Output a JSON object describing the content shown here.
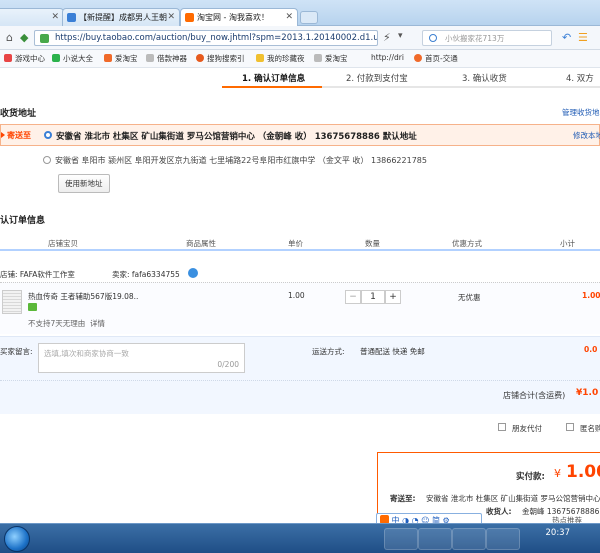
{
  "browser": {
    "tabs": [
      {
        "label": "",
        "active": false
      },
      {
        "label": "【新提醒】成都男人王朝",
        "active": false
      },
      {
        "label": "淘宝网 - 淘我喜欢！",
        "active": true
      }
    ],
    "address": "https://buy.taobao.com/auction/buy_now.jhtml?spm=2013.1.20140002.d1.und",
    "search_placeholder": "小伙搬家花713万",
    "bookmarks": [
      "游戏中心",
      "小说大全",
      "爱淘宝",
      "借款神器",
      "搜狗搜索引",
      "我的珍藏夜",
      "爱淘宝",
      "http://dri",
      "首页-交通"
    ]
  },
  "steps": [
    "1. 确认订单信息",
    "2. 付款到支付宝",
    "3. 确认收货",
    "4. 双方"
  ],
  "address_section": {
    "title": "收货地址",
    "manage_link": "管理收货地",
    "send_to": "寄送至",
    "selected": "安徽省 淮北市 杜集区 矿山集街道 罗马公馆营销中心 （金朝峰 收） 13675678886 默认地址",
    "modify": "修改本地",
    "other": "安徽省 阜阳市 颍州区 阜阳开发区京九街道 七里埔路22号阜阳市红旗中学 （金文平 收） 13866221785",
    "new_address_btn": "使用新地址"
  },
  "order_section": {
    "title": "认订单信息",
    "headers": [
      "店铺宝贝",
      "商品属性",
      "单价",
      "数量",
      "优惠方式",
      "小计"
    ],
    "shop_label": "店铺: FAFA软件工作室",
    "seller_label": "卖家: fafa6334755",
    "item_name": "热血传奇 王者辅助567版19.08..",
    "no_return": "不支持7天无理由",
    "detail": "详情",
    "price": "1.00",
    "qty": "1",
    "discount": "无优惠",
    "subtotal": "1.00",
    "minus": "−",
    "plus": "+"
  },
  "message": {
    "label": "买家留言:",
    "placeholder": "选填,填次和商家协商一致",
    "counter": "0/200"
  },
  "shipping": {
    "label": "运送方式:",
    "value": "普通配送 快递 免邮",
    "cost": "0.0"
  },
  "shop_total": {
    "label": "店铺合计(含运费)",
    "value": "¥1.0"
  },
  "options": {
    "friend_pay": "朋友代付",
    "anonymous": "匿名购"
  },
  "pay_box": {
    "label": "实付款:",
    "currency": "¥",
    "amount": "1.00",
    "send_label": "寄送至:",
    "send_addr": "安徽省 淮北市 杜集区 矿山集街道 罗马公馆营销中心",
    "receiver_label": "收货人:",
    "receiver": "金朝峰 13675678886"
  },
  "ime": {
    "text": "中 ◑ ◔ ☺ 简 ⚙",
    "hot": "热点推荐"
  },
  "taskbar": {
    "time": "20:37"
  },
  "colors": {
    "accent": "#ff4400",
    "link": "#1e5ab4",
    "selected_bg": "#fff1e8"
  }
}
